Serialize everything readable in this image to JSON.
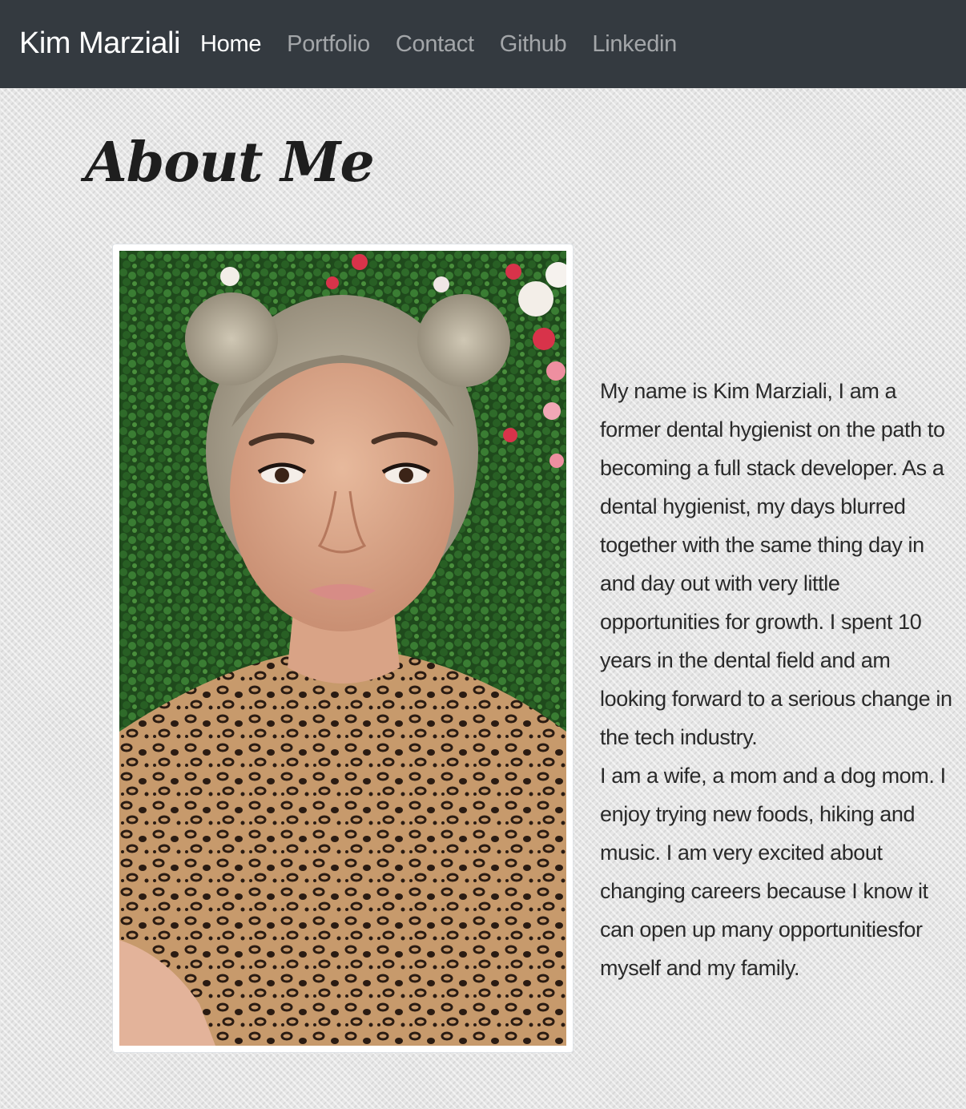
{
  "navbar": {
    "brand": "Kim Marziali",
    "links": [
      {
        "label": "Home",
        "active": true
      },
      {
        "label": "Portfolio",
        "active": false
      },
      {
        "label": "Contact",
        "active": false
      },
      {
        "label": "Github",
        "active": false
      },
      {
        "label": "Linkedin",
        "active": false
      }
    ]
  },
  "main": {
    "title": "About Me",
    "bio": [
      "My name is Kim Marziali, I am a former dental hygienist on the path to becoming a full stack developer. As a dental hygienist, my days blurred together with the same thing day in and day out with very little opportunities for growth. I spent 10 years in the dental field and am looking forward to a serious change in the tech industry.",
      "I am a wife, a mom and a dog mom. I enjoy trying new foods, hiking and music. I am very excited about changing careers because I know it can open up many opportunitiesfor myself and my family."
    ]
  },
  "colors": {
    "navbar_bg": "#343a40",
    "nav_active": "#ffffff",
    "nav_inactive": "rgba(255,255,255,0.55)",
    "text": "#2a2a2a"
  }
}
